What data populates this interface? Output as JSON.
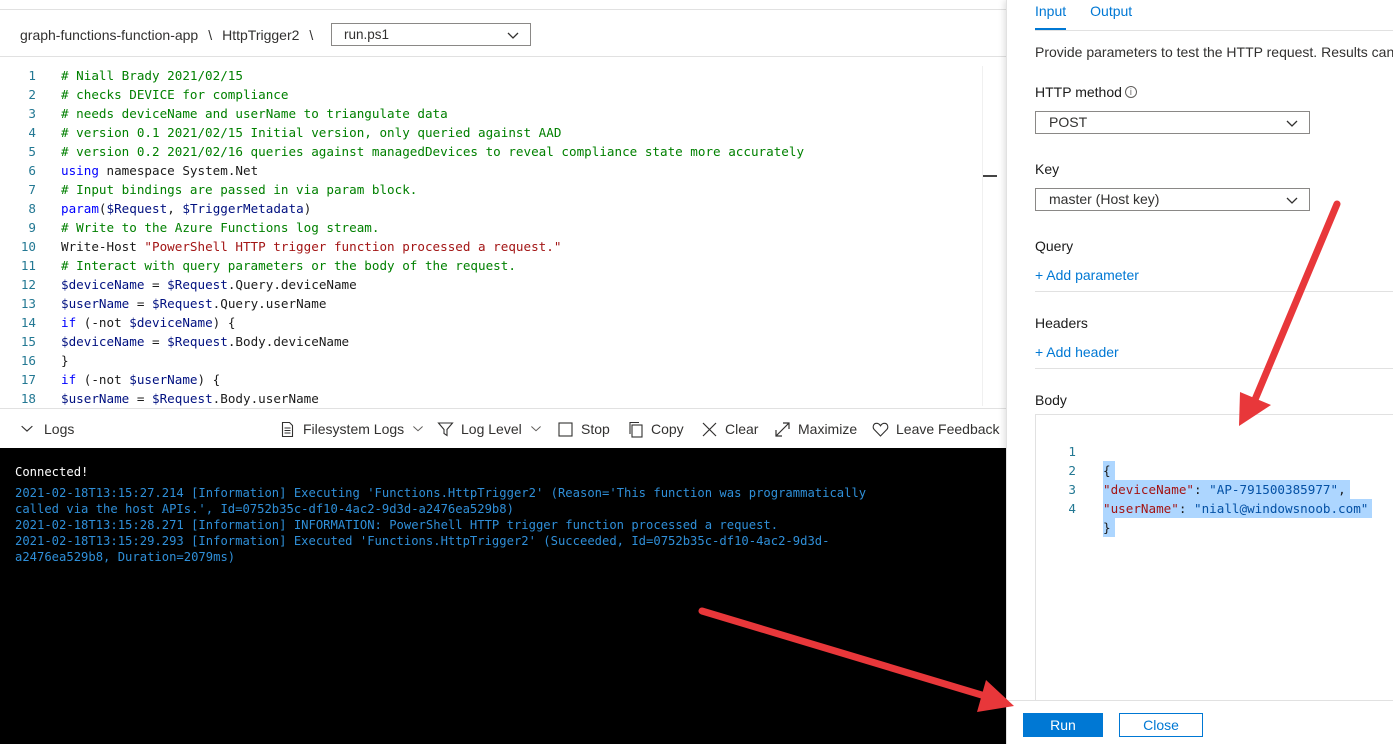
{
  "breadcrumb": {
    "app": "graph-functions-function-app",
    "sep1": "\\",
    "function": "HttpTrigger2",
    "sep2": "\\"
  },
  "file_select": {
    "value": "run.ps1"
  },
  "code": [
    {
      "n": "1",
      "parts": [
        [
          "comment",
          "# Niall Brady 2021/02/15"
        ]
      ]
    },
    {
      "n": "2",
      "parts": [
        [
          "comment",
          "# checks DEVICE for compliance"
        ]
      ]
    },
    {
      "n": "3",
      "parts": [
        [
          "comment",
          "# needs deviceName and userName to triangulate data"
        ]
      ]
    },
    {
      "n": "4",
      "parts": [
        [
          "comment",
          "# version 0.1 2021/02/15 Initial version, only queried against AAD"
        ]
      ]
    },
    {
      "n": "5",
      "parts": [
        [
          "comment",
          "# version 0.2 2021/02/16 queries against managedDevices to reveal compliance state more accurately"
        ]
      ]
    },
    {
      "n": "6",
      "parts": [
        [
          "kw",
          "using"
        ],
        [
          "plain",
          " namespace System.Net"
        ]
      ]
    },
    {
      "n": "7",
      "parts": [
        [
          "comment",
          "# Input bindings are passed in via param block."
        ]
      ]
    },
    {
      "n": "8",
      "parts": [
        [
          "kw",
          "param"
        ],
        [
          "plain",
          "("
        ],
        [
          "var",
          "$Request"
        ],
        [
          "plain",
          ", "
        ],
        [
          "var",
          "$TriggerMetadata"
        ],
        [
          "plain",
          ")"
        ]
      ]
    },
    {
      "n": "9",
      "parts": [
        [
          "comment",
          "# Write to the Azure Functions log stream."
        ]
      ]
    },
    {
      "n": "10",
      "parts": [
        [
          "plain",
          "Write-Host "
        ],
        [
          "str",
          "\"PowerShell HTTP trigger function processed a request.\""
        ]
      ]
    },
    {
      "n": "11",
      "parts": [
        [
          "comment",
          "# Interact with query parameters or the body of the request."
        ]
      ]
    },
    {
      "n": "12",
      "parts": [
        [
          "var",
          "$deviceName"
        ],
        [
          "plain",
          " = "
        ],
        [
          "var",
          "$Request"
        ],
        [
          "plain",
          ".Query.deviceName"
        ]
      ]
    },
    {
      "n": "13",
      "parts": [
        [
          "var",
          "$userName"
        ],
        [
          "plain",
          " = "
        ],
        [
          "var",
          "$Request"
        ],
        [
          "plain",
          ".Query.userName"
        ]
      ]
    },
    {
      "n": "14",
      "parts": [
        [
          "kw",
          "if"
        ],
        [
          "plain",
          " (-not "
        ],
        [
          "var",
          "$deviceName"
        ],
        [
          "plain",
          ") {"
        ]
      ]
    },
    {
      "n": "15",
      "parts": [
        [
          "var",
          "$deviceName"
        ],
        [
          "plain",
          " = "
        ],
        [
          "var",
          "$Request"
        ],
        [
          "plain",
          ".Body.deviceName"
        ]
      ]
    },
    {
      "n": "16",
      "parts": [
        [
          "plain",
          "}"
        ]
      ]
    },
    {
      "n": "17",
      "parts": [
        [
          "kw",
          "if"
        ],
        [
          "plain",
          " (-not "
        ],
        [
          "var",
          "$userName"
        ],
        [
          "plain",
          ") {"
        ]
      ]
    },
    {
      "n": "18",
      "parts": [
        [
          "var",
          "$userName"
        ],
        [
          "plain",
          " = "
        ],
        [
          "var",
          "$Request"
        ],
        [
          "plain",
          ".Body.userName"
        ]
      ]
    }
  ],
  "logbar": {
    "logs": "Logs",
    "filesystem": "Filesystem Logs",
    "level": "Log Level",
    "stop": "Stop",
    "copy": "Copy",
    "clear": "Clear",
    "maximize": "Maximize",
    "feedback": "Leave Feedback"
  },
  "console": {
    "connected": "Connected!",
    "lines": [
      "2021-02-18T13:15:27.214 [Information] Executing 'Functions.HttpTrigger2' (Reason='This function was programmatically",
      "called via the host APIs.', Id=0752b35c-df10-4ac2-9d3d-a2476ea529b8)",
      "2021-02-18T13:15:28.271 [Information] INFORMATION: PowerShell HTTP trigger function processed a request.",
      "2021-02-18T13:15:29.293 [Information] Executed 'Functions.HttpTrigger2' (Succeeded, Id=0752b35c-df10-4ac2-9d3d-",
      "a2476ea529b8, Duration=2079ms)"
    ]
  },
  "panel": {
    "tabs": {
      "input": "Input",
      "output": "Output"
    },
    "description": "Provide parameters to test the HTTP request. Results can b",
    "method": {
      "label": "HTTP method",
      "info": "i",
      "value": "POST"
    },
    "key": {
      "label": "Key",
      "value": "master (Host key)"
    },
    "query": {
      "label": "Query",
      "add": "+ Add parameter"
    },
    "headers": {
      "label": "Headers",
      "add": "+ Add header"
    },
    "body": {
      "label": "Body",
      "lines": [
        {
          "n": "1",
          "open": "{"
        },
        {
          "n": "2",
          "key": "\"deviceName\"",
          "colon": ": ",
          "val": "\"AP-791500385977\"",
          "end": ","
        },
        {
          "n": "3",
          "key": "\"userName\"",
          "colon": ": ",
          "val": "\"niall@windowsnoob.com\"",
          "end": ""
        },
        {
          "n": "4",
          "open": "}"
        }
      ]
    },
    "run": "Run",
    "close": "Close"
  },
  "colors": {
    "accent": "#0078d4",
    "arrow": "#e8373a",
    "log_text": "#2f8fd8"
  }
}
